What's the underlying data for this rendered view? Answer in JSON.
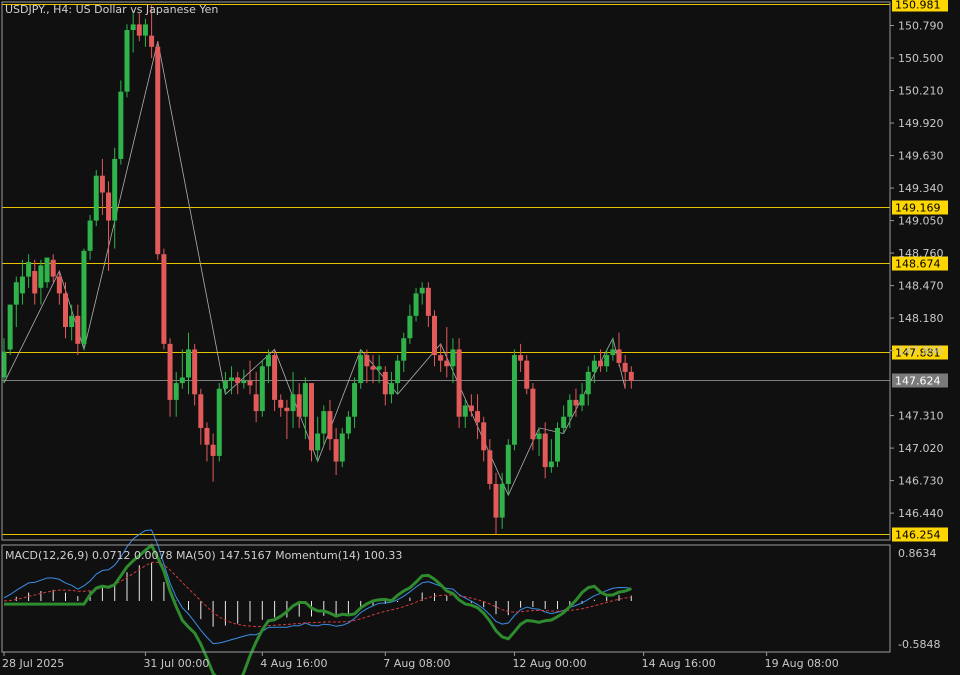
{
  "header": {
    "title": "USDJPY., H4:  US Dollar vs Japanese Yen",
    "indicator_title": "MACD(12,26,9) 0.0712 0.0078 MA(50) 147.5167 Momentum(14) 100.33"
  },
  "colors": {
    "background": "#101010",
    "bull": "#2fb34a",
    "bear": "#e25a5a",
    "level_line": "#e6c200",
    "level_label_bg": "#ffd700",
    "price_line": "#808080",
    "zigzag": "#b0b0b0",
    "macd_line": "#3a8ee6",
    "signal_line": "#d23c3c",
    "momentum_line": "#2e8b2e",
    "histogram": "#e8e8e8"
  },
  "price_axis": {
    "ticks": [
      "150.790",
      "150.500",
      "150.210",
      "149.920",
      "149.630",
      "149.340",
      "149.050",
      "148.760",
      "148.470",
      "148.180",
      "147.890",
      "147.310",
      "147.020",
      "146.730",
      "146.440"
    ]
  },
  "levels": [
    {
      "price": 150.981,
      "label": "150.981"
    },
    {
      "price": 149.169,
      "label": "149.169"
    },
    {
      "price": 148.674,
      "label": "148.674"
    },
    {
      "price": 147.881,
      "label": "147.881"
    },
    {
      "price": 146.254,
      "label": "146.254"
    }
  ],
  "current_price": {
    "price": 147.624,
    "label": "147.624"
  },
  "macd_axis": {
    "top_label": "0.8634",
    "bottom_label": "-0.5848"
  },
  "time_axis": {
    "labels": [
      {
        "bar": 0,
        "text": "28 Jul 2025"
      },
      {
        "bar": 23,
        "text": "31 Jul 00:00"
      },
      {
        "bar": 42,
        "text": "4 Aug 16:00"
      },
      {
        "bar": 62,
        "text": "7 Aug 08:00"
      },
      {
        "bar": 83,
        "text": "12 Aug 00:00"
      },
      {
        "bar": 104,
        "text": "14 Aug 16:00"
      },
      {
        "bar": 124,
        "text": "19 Aug 08:00"
      }
    ]
  },
  "chart_data": {
    "type": "candlestick",
    "symbol": "USDJPY.",
    "timeframe": "H4",
    "ylim": [
      146.2,
      151.0
    ],
    "candles": [
      {
        "o": 147.65,
        "h": 148.0,
        "l": 147.6,
        "c": 147.88
      },
      {
        "o": 147.9,
        "h": 148.3,
        "l": 147.85,
        "c": 148.3
      },
      {
        "o": 148.3,
        "h": 148.55,
        "l": 148.1,
        "c": 148.5
      },
      {
        "o": 148.4,
        "h": 148.7,
        "l": 148.3,
        "c": 148.55
      },
      {
        "o": 148.55,
        "h": 148.75,
        "l": 148.45,
        "c": 148.68
      },
      {
        "o": 148.6,
        "h": 148.7,
        "l": 148.3,
        "c": 148.4
      },
      {
        "o": 148.45,
        "h": 148.7,
        "l": 148.3,
        "c": 148.65
      },
      {
        "o": 148.5,
        "h": 148.7,
        "l": 148.45,
        "c": 148.72
      },
      {
        "o": 148.7,
        "h": 148.75,
        "l": 148.5,
        "c": 148.55
      },
      {
        "o": 148.55,
        "h": 148.6,
        "l": 148.3,
        "c": 148.4
      },
      {
        "o": 148.4,
        "h": 148.5,
        "l": 148.0,
        "c": 148.1
      },
      {
        "o": 148.1,
        "h": 148.3,
        "l": 147.98,
        "c": 148.2
      },
      {
        "o": 148.2,
        "h": 148.3,
        "l": 147.85,
        "c": 147.95
      },
      {
        "o": 147.95,
        "h": 148.8,
        "l": 147.9,
        "c": 148.78
      },
      {
        "o": 148.78,
        "h": 149.1,
        "l": 148.7,
        "c": 149.05
      },
      {
        "o": 149.05,
        "h": 149.5,
        "l": 149.0,
        "c": 149.45
      },
      {
        "o": 149.45,
        "h": 149.6,
        "l": 149.1,
        "c": 149.3
      },
      {
        "o": 149.3,
        "h": 149.4,
        "l": 148.6,
        "c": 149.05
      },
      {
        "o": 149.05,
        "h": 149.7,
        "l": 148.8,
        "c": 149.6
      },
      {
        "o": 149.6,
        "h": 150.3,
        "l": 149.55,
        "c": 150.2
      },
      {
        "o": 150.2,
        "h": 150.8,
        "l": 150.15,
        "c": 150.75
      },
      {
        "o": 150.75,
        "h": 150.9,
        "l": 150.55,
        "c": 150.8
      },
      {
        "o": 150.8,
        "h": 150.9,
        "l": 150.65,
        "c": 150.7
      },
      {
        "o": 150.7,
        "h": 150.85,
        "l": 150.6,
        "c": 150.8
      },
      {
        "o": 150.7,
        "h": 150.98,
        "l": 150.5,
        "c": 150.6
      },
      {
        "o": 150.6,
        "h": 150.65,
        "l": 148.7,
        "c": 148.75
      },
      {
        "o": 148.75,
        "h": 148.8,
        "l": 147.9,
        "c": 147.95
      },
      {
        "o": 147.95,
        "h": 148.0,
        "l": 147.3,
        "c": 147.45
      },
      {
        "o": 147.45,
        "h": 147.7,
        "l": 147.3,
        "c": 147.6
      },
      {
        "o": 147.6,
        "h": 147.9,
        "l": 147.55,
        "c": 147.65
      },
      {
        "o": 147.65,
        "h": 148.05,
        "l": 147.5,
        "c": 147.9
      },
      {
        "o": 147.9,
        "h": 147.95,
        "l": 147.4,
        "c": 147.5
      },
      {
        "o": 147.5,
        "h": 147.55,
        "l": 147.05,
        "c": 147.2
      },
      {
        "o": 147.2,
        "h": 147.25,
        "l": 146.9,
        "c": 147.05
      },
      {
        "o": 147.05,
        "h": 147.15,
        "l": 146.72,
        "c": 146.95
      },
      {
        "o": 146.95,
        "h": 147.6,
        "l": 146.9,
        "c": 147.55
      },
      {
        "o": 147.55,
        "h": 147.7,
        "l": 147.5,
        "c": 147.62
      },
      {
        "o": 147.62,
        "h": 147.75,
        "l": 147.5,
        "c": 147.65
      },
      {
        "o": 147.65,
        "h": 147.7,
        "l": 147.5,
        "c": 147.6
      },
      {
        "o": 147.6,
        "h": 147.72,
        "l": 147.55,
        "c": 147.62
      },
      {
        "o": 147.62,
        "h": 147.8,
        "l": 147.5,
        "c": 147.58
      },
      {
        "o": 147.5,
        "h": 147.7,
        "l": 147.25,
        "c": 147.35
      },
      {
        "o": 147.35,
        "h": 147.8,
        "l": 147.3,
        "c": 147.75
      },
      {
        "o": 147.75,
        "h": 147.9,
        "l": 147.6,
        "c": 147.85
      },
      {
        "o": 147.85,
        "h": 147.9,
        "l": 147.35,
        "c": 147.45
      },
      {
        "o": 147.45,
        "h": 147.5,
        "l": 147.3,
        "c": 147.38
      },
      {
        "o": 147.38,
        "h": 147.45,
        "l": 147.1,
        "c": 147.35
      },
      {
        "o": 147.35,
        "h": 147.7,
        "l": 147.2,
        "c": 147.5
      },
      {
        "o": 147.5,
        "h": 147.6,
        "l": 147.2,
        "c": 147.3
      },
      {
        "o": 147.3,
        "h": 147.65,
        "l": 147.1,
        "c": 147.6
      },
      {
        "o": 147.6,
        "h": 147.6,
        "l": 146.9,
        "c": 147.0
      },
      {
        "o": 147.0,
        "h": 147.3,
        "l": 146.9,
        "c": 147.15
      },
      {
        "o": 147.15,
        "h": 147.4,
        "l": 147.05,
        "c": 147.35
      },
      {
        "o": 147.35,
        "h": 147.45,
        "l": 147.0,
        "c": 147.1
      },
      {
        "o": 147.1,
        "h": 147.2,
        "l": 146.78,
        "c": 146.9
      },
      {
        "o": 146.9,
        "h": 147.2,
        "l": 146.85,
        "c": 147.15
      },
      {
        "o": 147.15,
        "h": 147.35,
        "l": 147.1,
        "c": 147.3
      },
      {
        "o": 147.3,
        "h": 147.65,
        "l": 147.2,
        "c": 147.6
      },
      {
        "o": 147.6,
        "h": 147.9,
        "l": 147.55,
        "c": 147.85
      },
      {
        "o": 147.85,
        "h": 147.9,
        "l": 147.6,
        "c": 147.75
      },
      {
        "o": 147.75,
        "h": 147.85,
        "l": 147.6,
        "c": 147.72
      },
      {
        "o": 147.72,
        "h": 147.85,
        "l": 147.6,
        "c": 147.75
      },
      {
        "o": 147.7,
        "h": 147.75,
        "l": 147.4,
        "c": 147.5
      },
      {
        "o": 147.5,
        "h": 147.7,
        "l": 147.42,
        "c": 147.6
      },
      {
        "o": 147.6,
        "h": 147.85,
        "l": 147.5,
        "c": 147.8
      },
      {
        "o": 147.8,
        "h": 148.05,
        "l": 147.7,
        "c": 148.0
      },
      {
        "o": 148.0,
        "h": 148.3,
        "l": 147.95,
        "c": 148.2
      },
      {
        "o": 148.2,
        "h": 148.45,
        "l": 148.15,
        "c": 148.4
      },
      {
        "o": 148.4,
        "h": 148.5,
        "l": 148.3,
        "c": 148.45
      },
      {
        "o": 148.45,
        "h": 148.5,
        "l": 148.1,
        "c": 148.2
      },
      {
        "o": 148.2,
        "h": 148.25,
        "l": 147.75,
        "c": 147.85
      },
      {
        "o": 147.85,
        "h": 147.95,
        "l": 147.7,
        "c": 147.8
      },
      {
        "o": 147.8,
        "h": 148.1,
        "l": 147.65,
        "c": 147.75
      },
      {
        "o": 147.75,
        "h": 148.0,
        "l": 147.6,
        "c": 147.9
      },
      {
        "o": 147.9,
        "h": 148.0,
        "l": 147.2,
        "c": 147.3
      },
      {
        "o": 147.3,
        "h": 147.45,
        "l": 147.2,
        "c": 147.4
      },
      {
        "o": 147.4,
        "h": 147.5,
        "l": 147.3,
        "c": 147.35
      },
      {
        "o": 147.35,
        "h": 147.5,
        "l": 147.1,
        "c": 147.25
      },
      {
        "o": 147.25,
        "h": 147.3,
        "l": 146.9,
        "c": 147.0
      },
      {
        "o": 147.0,
        "h": 147.1,
        "l": 146.65,
        "c": 146.7
      },
      {
        "o": 146.7,
        "h": 146.8,
        "l": 146.25,
        "c": 146.4
      },
      {
        "o": 146.4,
        "h": 146.8,
        "l": 146.3,
        "c": 146.7
      },
      {
        "o": 146.7,
        "h": 147.1,
        "l": 146.6,
        "c": 147.05
      },
      {
        "o": 147.05,
        "h": 147.9,
        "l": 147.0,
        "c": 147.85
      },
      {
        "o": 147.85,
        "h": 147.95,
        "l": 147.7,
        "c": 147.8
      },
      {
        "o": 147.8,
        "h": 147.85,
        "l": 147.5,
        "c": 147.55
      },
      {
        "o": 147.55,
        "h": 147.6,
        "l": 147.0,
        "c": 147.1
      },
      {
        "o": 147.1,
        "h": 147.2,
        "l": 146.95,
        "c": 147.15
      },
      {
        "o": 147.15,
        "h": 147.25,
        "l": 146.75,
        "c": 146.85
      },
      {
        "o": 146.85,
        "h": 147.1,
        "l": 146.8,
        "c": 146.9
      },
      {
        "o": 146.9,
        "h": 147.25,
        "l": 146.85,
        "c": 147.2
      },
      {
        "o": 147.2,
        "h": 147.4,
        "l": 147.15,
        "c": 147.3
      },
      {
        "o": 147.3,
        "h": 147.5,
        "l": 147.2,
        "c": 147.45
      },
      {
        "o": 147.45,
        "h": 147.55,
        "l": 147.3,
        "c": 147.4
      },
      {
        "o": 147.4,
        "h": 147.6,
        "l": 147.35,
        "c": 147.5
      },
      {
        "o": 147.5,
        "h": 147.75,
        "l": 147.4,
        "c": 147.7
      },
      {
        "o": 147.7,
        "h": 147.85,
        "l": 147.6,
        "c": 147.8
      },
      {
        "o": 147.8,
        "h": 147.9,
        "l": 147.7,
        "c": 147.75
      },
      {
        "o": 147.75,
        "h": 147.9,
        "l": 147.7,
        "c": 147.85
      },
      {
        "o": 147.85,
        "h": 148.0,
        "l": 147.8,
        "c": 147.9
      },
      {
        "o": 147.9,
        "h": 148.05,
        "l": 147.75,
        "c": 147.78
      },
      {
        "o": 147.78,
        "h": 147.85,
        "l": 147.55,
        "c": 147.7
      },
      {
        "o": 147.7,
        "h": 147.75,
        "l": 147.55,
        "c": 147.62
      }
    ]
  }
}
